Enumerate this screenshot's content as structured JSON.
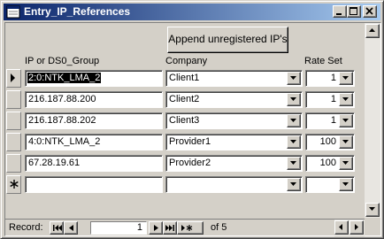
{
  "window": {
    "title": "Entry_IP_References"
  },
  "toolbar": {
    "append_button_label": "Append unregistered IP's"
  },
  "columns": {
    "ip": "IP or DS0_Group",
    "company": "Company",
    "rate": "Rate Set"
  },
  "rows": [
    {
      "ip": "2:0:NTK_LMA_2",
      "company": "Client1",
      "rate": "1",
      "current": true
    },
    {
      "ip": "216.187.88.200",
      "company": "Client2",
      "rate": "1"
    },
    {
      "ip": "216.187.88.202",
      "company": "Client3",
      "rate": "1"
    },
    {
      "ip": "4:0:NTK_LMA_2",
      "company": "Provider1",
      "rate": "100"
    },
    {
      "ip": "67.28.19.61",
      "company": "Provider2",
      "rate": "100"
    }
  ],
  "new_row": {
    "ip": "",
    "company": "",
    "rate": ""
  },
  "navigation": {
    "record_label": "Record:",
    "current_record": "1",
    "of_label": "of",
    "total_records": "5"
  },
  "colors": {
    "title_start": "#0a246a",
    "title_end": "#a6caf0",
    "face": "#d4d0c8",
    "selection": "#000000"
  },
  "icons": {
    "title": "form-icon",
    "minimize": "minimize-icon",
    "maximize": "maximize-icon",
    "close": "close-icon",
    "current_record": "record-pointer-icon",
    "new_record": "new-record-asterisk-icon",
    "dropdown": "chevron-down-icon"
  }
}
